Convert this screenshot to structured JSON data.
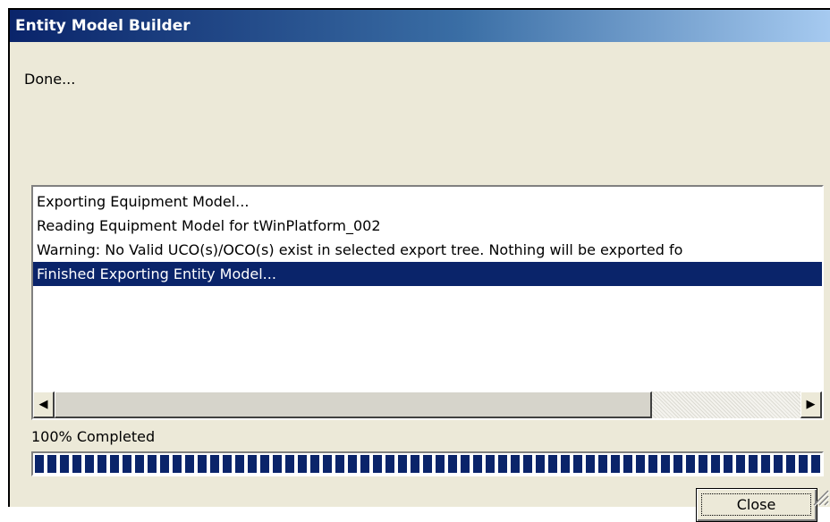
{
  "window": {
    "title": "Entity Model Builder"
  },
  "status": {
    "text": "Done..."
  },
  "log": {
    "lines": [
      {
        "text": "Exporting Equipment Model...",
        "selected": false
      },
      {
        "text": "Reading Equipment Model for tWinPlatform_002",
        "selected": false
      },
      {
        "text": "Warning: No Valid UCO(s)/OCO(s) exist in selected export tree. Nothing will be exported fo",
        "selected": false
      },
      {
        "text": "Finished Exporting Entity Model...",
        "selected": true
      }
    ],
    "scrollbar": {
      "left_icon": "◀",
      "right_icon": "▶"
    }
  },
  "progress": {
    "label": "100% Completed",
    "value_percent": 100
  },
  "buttons": {
    "close": "Close"
  },
  "colors": {
    "selection": "#0a246a",
    "progress_fill": "#0a246a"
  }
}
